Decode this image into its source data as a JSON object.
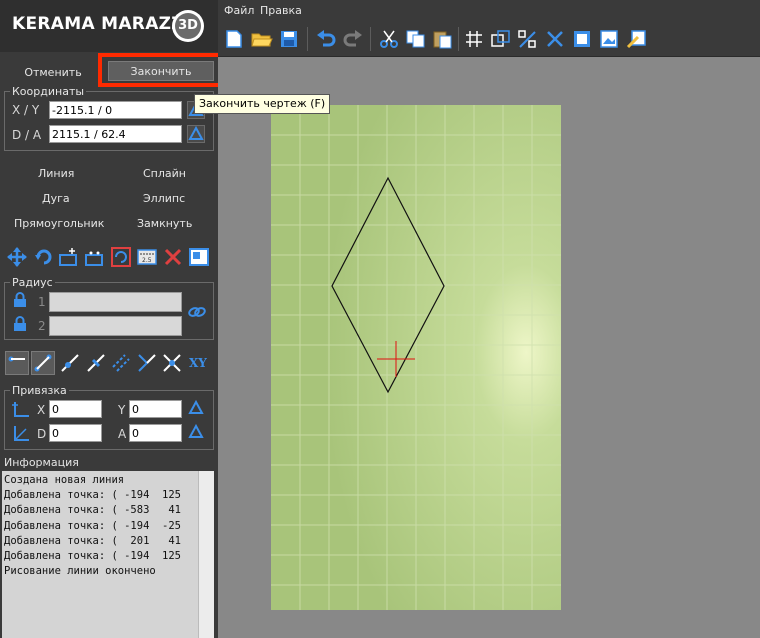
{
  "app": {
    "logo": "KERAMA MARAZZI",
    "logo_badge": "3D"
  },
  "menu": {
    "file": "Файл",
    "edit": "Правка"
  },
  "actions": {
    "cancel": "Отменить",
    "finish": "Закончить",
    "tooltip": "Закончить чертеж (F)"
  },
  "coords": {
    "title": "Координаты",
    "xy_label": "X / Y",
    "xy_value": "-2115.1 / 0",
    "da_label": "D / A",
    "da_value": "2115.1 / 62.4"
  },
  "shapes": {
    "line": "Линия",
    "spline": "Сплайн",
    "arc": "Дуга",
    "ellipse": "Эллипс",
    "rect": "Прямоугольник",
    "close": "Замкнуть"
  },
  "radius": {
    "title": "Радиус",
    "r1": "1",
    "r2": "2"
  },
  "xy_button": "XY",
  "snap": {
    "title": "Привязка",
    "x_label": "X",
    "x_value": "0",
    "y_label": "Y",
    "y_value": "0",
    "d_label": "D",
    "d_value": "0",
    "a_label": "A",
    "a_value": "0"
  },
  "info": {
    "title": "Информация",
    "lines": [
      "Создана новая линия",
      "Добавлена точка: ( -194  125",
      "Добавлена точка: ( -583   41",
      "Добавлена точка: ( -194  -25",
      "Добавлена точка: (  201   41",
      "Добавлена точка: ( -194  125",
      "Рисование линии окончено"
    ]
  },
  "colors": {
    "accent_highlight": "#ff2a00",
    "sheet": "#b8d08a",
    "panel": "#3a3a3a",
    "icon_blue": "#3b8ee8"
  }
}
